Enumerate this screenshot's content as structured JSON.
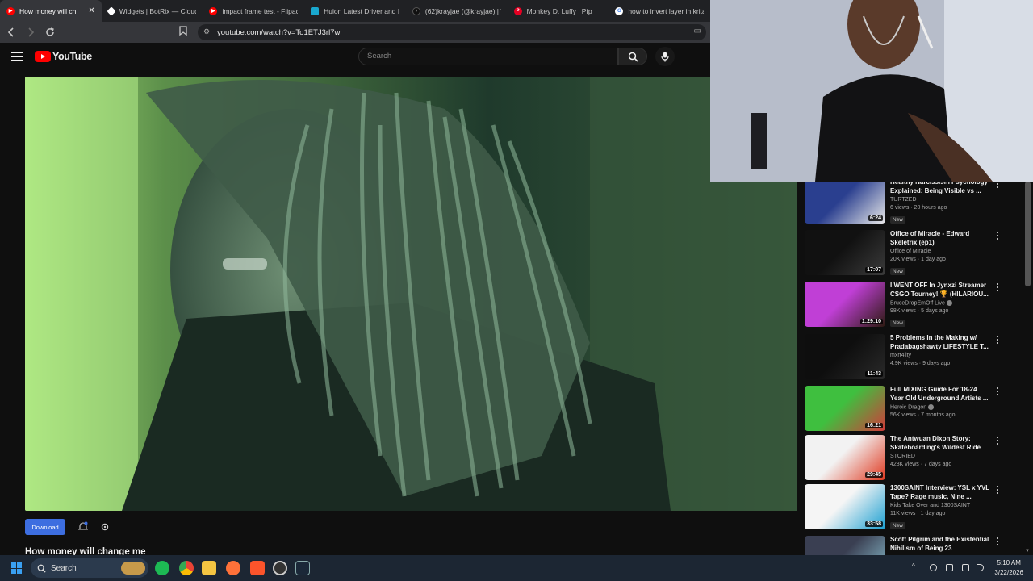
{
  "browser": {
    "tabs": [
      {
        "title": "How money will ch",
        "favicon_color": "#ff0000",
        "active": true
      },
      {
        "title": "Widgets | BotRix — Cloud",
        "favicon_color": "#ffffff",
        "active": false
      },
      {
        "title": "impact frame test - Flipacl",
        "favicon_color": "#ff0000",
        "active": false
      },
      {
        "title": "Huion Latest Driver and M",
        "favicon_color": "#19a7ce",
        "active": false
      },
      {
        "title": "(62)krayjae (@krayjae) | Ti",
        "favicon_color": "#111111",
        "active": false
      },
      {
        "title": "Monkey D. Luffy | Pfp",
        "favicon_color": "#e60023",
        "active": false
      },
      {
        "title": "how to invert layer in krita",
        "favicon_color": "#4285f4",
        "active": false
      }
    ],
    "close_glyph": "✕",
    "url": "youtube.com/watch?v=To1ETJ3rl7w"
  },
  "youtube": {
    "logo_text": "YouTube",
    "search_placeholder": "Search",
    "video_title": "How money will change me",
    "download_label": "Download",
    "recommendations": [
      {
        "title": "Healthy Narcissism Psychology Explained: Being Visible vs ...",
        "channel": "TURTZED",
        "meta": "6 views · 20 hours ago",
        "badge": "New",
        "duration": "6:24",
        "verified": false,
        "thumb_colors": [
          "#2a3f8f",
          "#e9e9e9"
        ]
      },
      {
        "title": "Office of Miracle - Edward Skeletrix (ep1)",
        "channel": "Office of Miracle",
        "meta": "20K views · 1 day ago",
        "badge": "New",
        "duration": "17:07",
        "verified": false,
        "thumb_colors": [
          "#111111",
          "#3b3b3b"
        ]
      },
      {
        "title": "I WENT OFF In Jynxzi Streamer CSGO Tourney! 🏆 (HILARIOU...",
        "channel": "BruceDropEmOff Live",
        "meta": "98K views · 5 days ago",
        "badge": "New",
        "duration": "1:29:10",
        "verified": true,
        "thumb_colors": [
          "#c03fd6",
          "#2c1a10"
        ]
      },
      {
        "title": "5 Problems In the Making w/ Pradabagshawty LIFESTYLE T...",
        "channel": "mxrt4lity",
        "meta": "4.9K views · 9 days ago",
        "badge": "",
        "duration": "11:43",
        "verified": false,
        "thumb_colors": [
          "#0e0e0e",
          "#2a2a2a"
        ]
      },
      {
        "title": "Full MIXING Guide For 18-24 Year Old Underground Artists ...",
        "channel": "Heroic Dragon",
        "meta": "56K views · 7 months ago",
        "badge": "",
        "duration": "16:21",
        "verified": true,
        "thumb_colors": [
          "#3fbf3f",
          "#d23a3a"
        ]
      },
      {
        "title": "The Antwuan Dixon Story: Skateboarding's Wildest Ride",
        "channel": "STORIED",
        "meta": "428K views · 7 days ago",
        "badge": "",
        "duration": "29:45",
        "verified": false,
        "thumb_colors": [
          "#f2f2f2",
          "#e0381f"
        ]
      },
      {
        "title": "1300SAINT Interview: YSL x YVL Tape? Rage music, Nine ...",
        "channel": "Kids Take Over and 1300SAINT",
        "meta": "11K views · 1 day ago",
        "badge": "New",
        "duration": "33:58",
        "verified": false,
        "thumb_colors": [
          "#f5f5f5",
          "#1a9fd1"
        ]
      },
      {
        "title": "Scott Pilgrim and the Existential Nihilism of Being 23",
        "channel": "",
        "meta": "",
        "badge": "",
        "duration": "",
        "verified": false,
        "thumb_colors": [
          "#3a3f52",
          "#8fc6d6"
        ]
      }
    ]
  },
  "taskbar": {
    "search_placeholder": "Search",
    "time": "5:10 AM",
    "date": "3/22/2026"
  },
  "icons": [
    "menu-icon",
    "search-icon",
    "mic-icon",
    "bell-icon",
    "gear-icon",
    "back-icon",
    "forward-icon",
    "reload-icon",
    "bookmark-icon",
    "windows-start-icon"
  ]
}
